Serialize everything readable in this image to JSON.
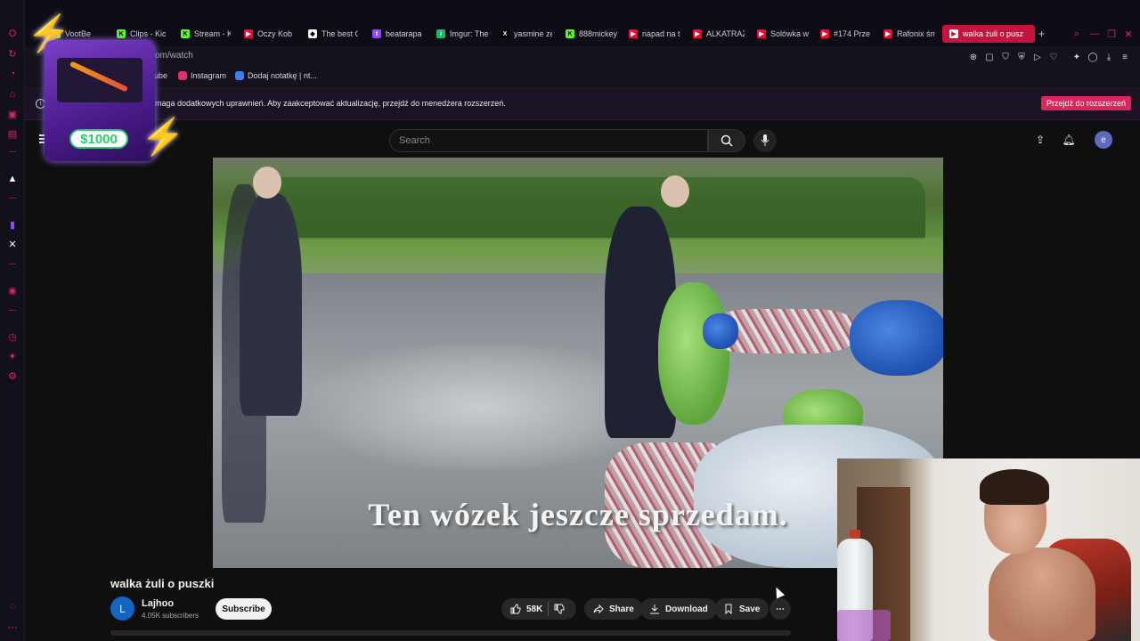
{
  "browser": {
    "tabs": [
      {
        "label": "VootBe",
        "color": "#53fc18",
        "glyph": "K"
      },
      {
        "label": "Clips - Kic",
        "color": "#53fc18",
        "glyph": "K"
      },
      {
        "label": "Stream - K",
        "color": "#53fc18",
        "glyph": "K"
      },
      {
        "label": "Oczy Kob",
        "color": "#ff0033",
        "glyph": "▶"
      },
      {
        "label": "The best C",
        "color": "#ffffff",
        "glyph": "◆"
      },
      {
        "label": "beatarapa",
        "color": "#9146ff",
        "glyph": "t"
      },
      {
        "label": "Imgur: The",
        "color": "#1bb76e",
        "glyph": "i"
      },
      {
        "label": "yasmine ze",
        "color": "#000000",
        "glyph": "X"
      },
      {
        "label": "888mickey",
        "color": "#53fc18",
        "glyph": "K"
      },
      {
        "label": "napad na t",
        "color": "#ff0033",
        "glyph": "▶"
      },
      {
        "label": "ALKATRAZ",
        "color": "#ff0033",
        "glyph": "▶"
      },
      {
        "label": "Solówka w",
        "color": "#ff0033",
        "glyph": "▶"
      },
      {
        "label": "#174 Prze",
        "color": "#ff0033",
        "glyph": "▶"
      },
      {
        "label": "Rafonix śm",
        "color": "#ff0033",
        "glyph": "▶"
      },
      {
        "label": "walka żuli o pusz",
        "color": "#ff0033",
        "glyph": "▶"
      }
    ],
    "new_tab_label": "+",
    "url_text": "om/watch",
    "bookmarks": [
      {
        "label": "ube",
        "color": "#ff0033"
      },
      {
        "label": "Instagram",
        "color": "#e1306c"
      },
      {
        "label": "Dodaj notatkę | nt...",
        "color": "#3b82f6"
      }
    ],
    "extension_notice": "maga dodatkowych uprawnień. Aby zaakceptować aktualizację, przejdź do menedżera rozszerzeń.",
    "extension_button": "Przejdź do rozszerzeń"
  },
  "youtube": {
    "search_placeholder": "Search",
    "avatar_letter": "e",
    "video": {
      "subtitle": "Ten wózek jeszcze sprzedam.",
      "title": "walka żuli o puszki"
    },
    "channel": {
      "name": "Lajhoo",
      "avatar_letter": "L",
      "subscribers": "4.05K subscribers",
      "subscribe_label": "Subscribe"
    },
    "actions": {
      "likes": "58K",
      "share": "Share",
      "download": "Download",
      "save": "Save",
      "more": "⋯"
    }
  },
  "overlay": {
    "promo_price": "$1000"
  },
  "colors": {
    "accent": "#e0245e",
    "active_tab": "#c4133c",
    "yt_bg": "#0f0f0f",
    "pill_bg": "#272727"
  }
}
